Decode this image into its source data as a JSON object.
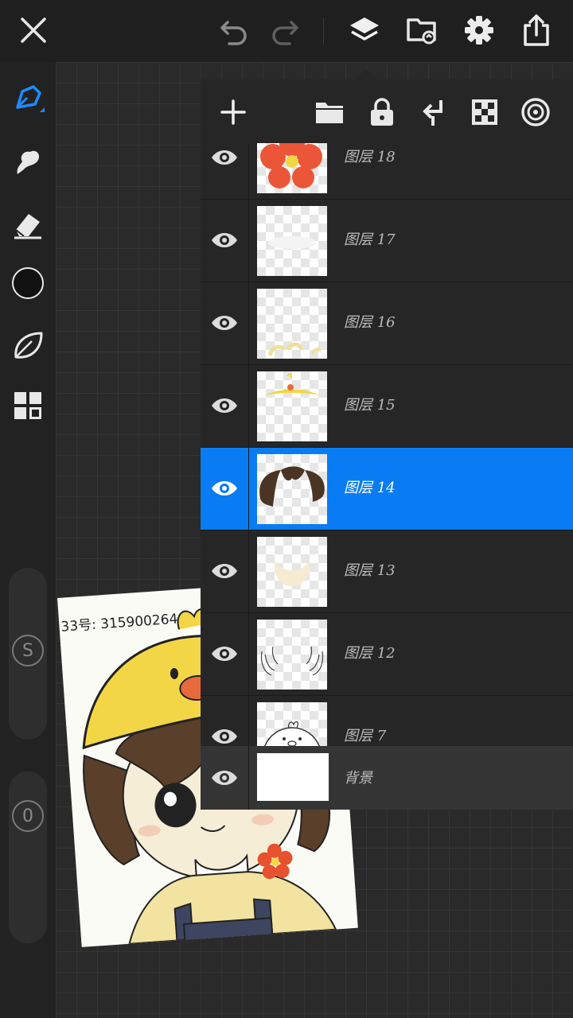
{
  "topbar": {
    "icons": [
      "close-icon",
      "undo-icon",
      "redo-icon",
      "layers-icon",
      "import-icon",
      "settings-icon",
      "share-icon"
    ]
  },
  "sidebar": {
    "tools": [
      "brush-icon",
      "smudge-icon",
      "eraser-icon",
      "color-swatch",
      "liquify-icon",
      "gallery-icon"
    ],
    "color": "#121212",
    "size_label": "S",
    "opacity_label": "0"
  },
  "artwork": {
    "caption": "33号: 315900264"
  },
  "layers_panel": {
    "toolbar": [
      "add-icon",
      "folder-icon",
      "lock-icon",
      "merge-down-icon",
      "transparency-icon",
      "layer-mode-icon"
    ],
    "layers": [
      {
        "name": "图层 18",
        "selected": false,
        "thumb": "flower"
      },
      {
        "name": "图层 17",
        "selected": false,
        "thumb": "blank"
      },
      {
        "name": "图层 16",
        "selected": false,
        "thumb": "yellow-spots"
      },
      {
        "name": "图层 15",
        "selected": false,
        "thumb": "hat-brim"
      },
      {
        "name": "图层 14",
        "selected": true,
        "thumb": "hair"
      },
      {
        "name": "图层 13",
        "selected": false,
        "thumb": "cream-shape"
      },
      {
        "name": "图层 12",
        "selected": false,
        "thumb": "lines"
      },
      {
        "name": "图层 7",
        "selected": false,
        "thumb": "bird"
      }
    ],
    "background_layer": {
      "name": "背景"
    },
    "accent": "#0a7cf3"
  }
}
